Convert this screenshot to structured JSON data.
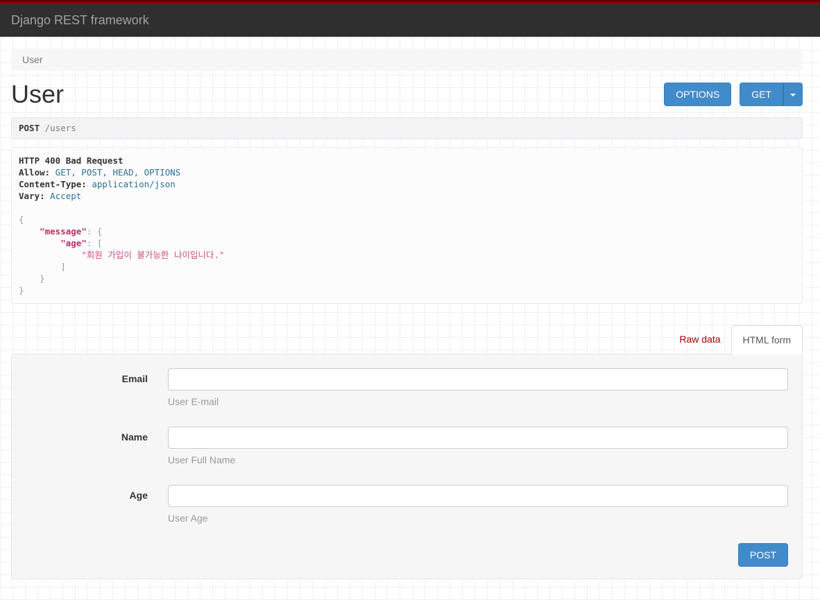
{
  "navbar": {
    "brand": "Django REST framework"
  },
  "breadcrumb": {
    "items": [
      "User"
    ]
  },
  "page": {
    "title": "User"
  },
  "actions": {
    "options_label": "OPTIONS",
    "get_label": "GET"
  },
  "request": {
    "method": "POST",
    "path": " /users"
  },
  "response": {
    "status_line": "HTTP 400 Bad Request",
    "headers": [
      {
        "name": "Allow:",
        "value": " GET, POST, HEAD, OPTIONS"
      },
      {
        "name": "Content-Type:",
        "value": " application/json"
      },
      {
        "name": "Vary:",
        "value": " Accept"
      }
    ],
    "body_lines": [
      [
        {
          "t": "{",
          "c": "p"
        }
      ],
      [
        {
          "t": "    ",
          "c": "p"
        },
        {
          "t": "\"message\"",
          "c": "k"
        },
        {
          "t": ": {",
          "c": "p"
        }
      ],
      [
        {
          "t": "        ",
          "c": "p"
        },
        {
          "t": "\"age\"",
          "c": "k"
        },
        {
          "t": ": [",
          "c": "p"
        }
      ],
      [
        {
          "t": "            ",
          "c": "p"
        },
        {
          "t": "\"회원 가입이 불가능한 나이입니다.\"",
          "c": "s"
        }
      ],
      [
        {
          "t": "        ]",
          "c": "p"
        }
      ],
      [
        {
          "t": "    }",
          "c": "p"
        }
      ],
      [
        {
          "t": "}",
          "c": "p"
        }
      ]
    ]
  },
  "tabs": [
    {
      "label": "Raw data",
      "active": false
    },
    {
      "label": "HTML form",
      "active": true
    }
  ],
  "form": {
    "fields": [
      {
        "label": "Email",
        "value": "",
        "help": "User E-mail"
      },
      {
        "label": "Name",
        "value": "",
        "help": "User Full Name"
      },
      {
        "label": "Age",
        "value": "",
        "help": "User Age"
      }
    ],
    "submit_label": "POST"
  },
  "colors": {
    "accent": "#428bca",
    "accent_border": "#357ebd",
    "danger": "#a30000",
    "json_key": "#b93163",
    "json_string": "#d14b7e",
    "header_value": "#2d6e96",
    "navbar_bg": "#2f2f2f",
    "brand_text": "#a2a2a2",
    "top_strip": "#a60404"
  }
}
